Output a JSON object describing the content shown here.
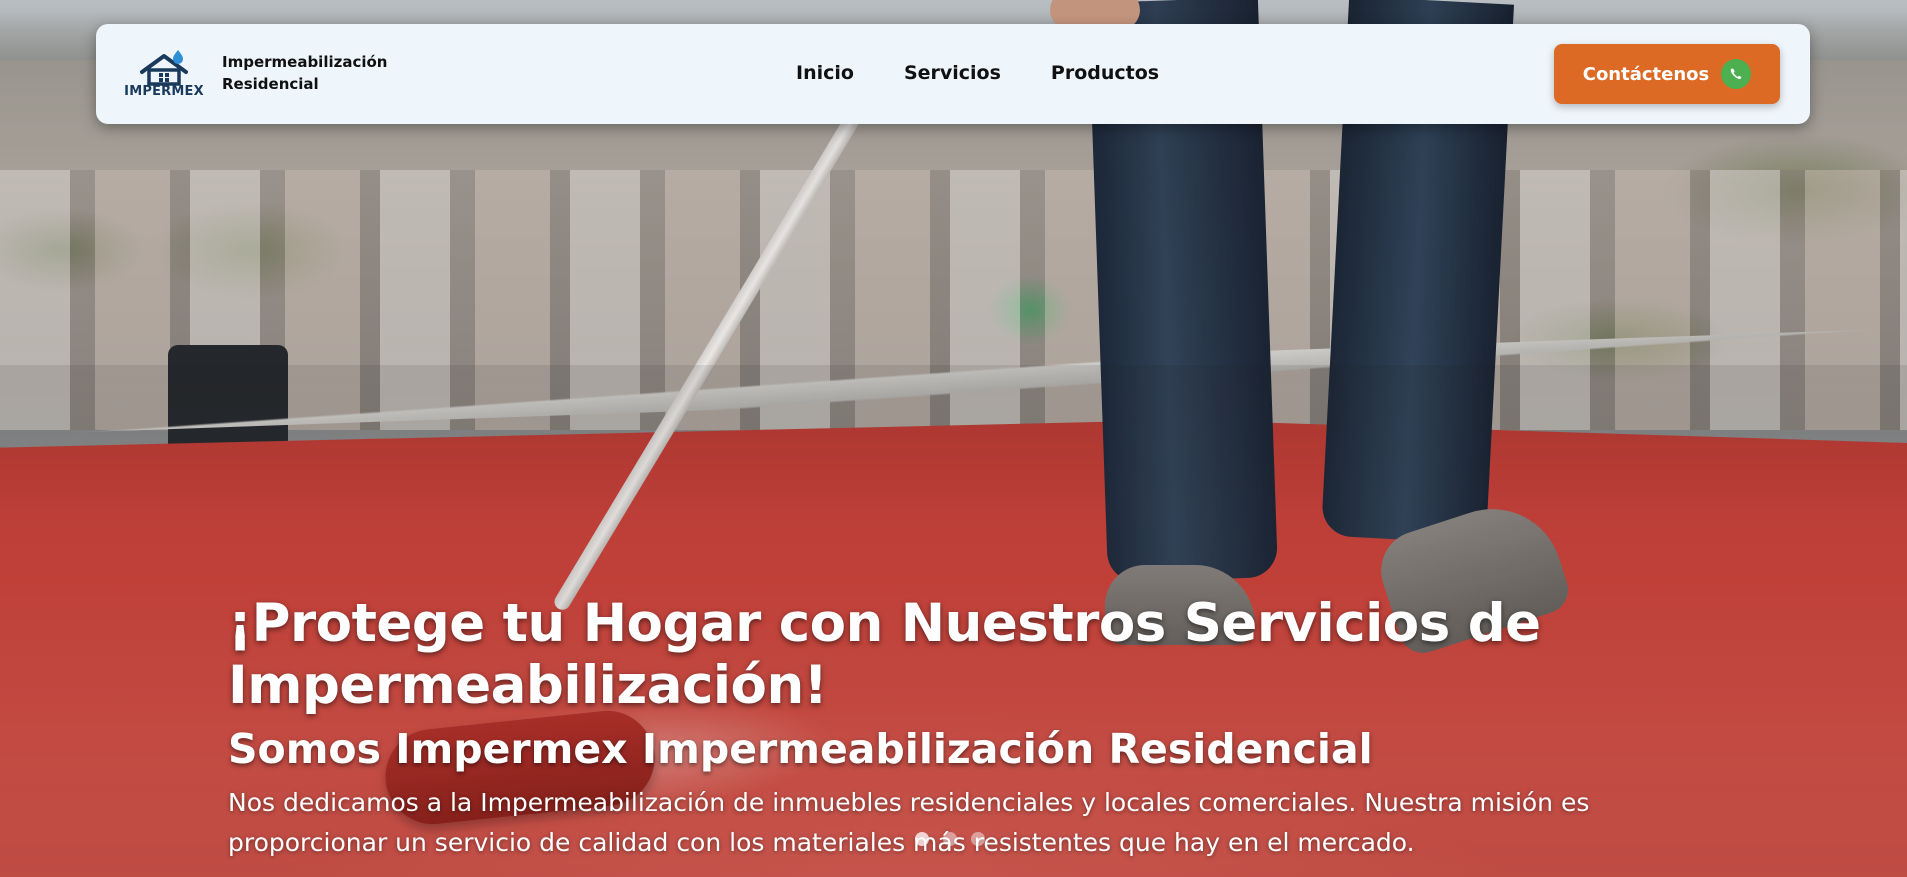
{
  "brand": {
    "logo_text": "IMPERMEX",
    "name_line1": "Impermeabilización",
    "name_line2": "Residencial",
    "logo_color": "#1a3a5c",
    "drop_color": "#2f8fd6"
  },
  "nav": {
    "items": [
      {
        "label": "Inicio"
      },
      {
        "label": "Servicios"
      },
      {
        "label": "Productos"
      }
    ]
  },
  "cta": {
    "label": "Contáctenos",
    "icon": "whatsapp-icon",
    "color": "#dc6a24"
  },
  "hero": {
    "title": "¡Protege tu Hogar con Nuestros Servicios de Impermeabilización!",
    "subtitle": "Somos Impermex Impermeabilización Residencial",
    "description": "Nos dedicamos a la Impermeabilización de inmuebles residenciales y locales comerciales. Nuestra misión es proporcionar un servicio de calidad con los materiales más resistentes que hay en el mercado.",
    "background_image": "worker-painting-red-roof-photo"
  },
  "carousel": {
    "slides": 3,
    "active_index": 0
  }
}
